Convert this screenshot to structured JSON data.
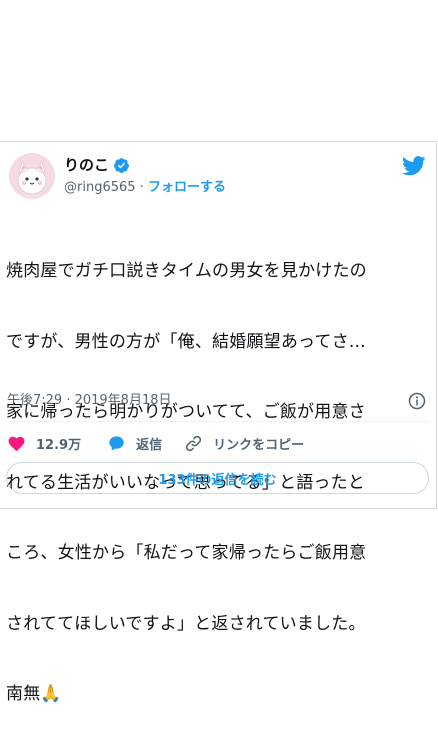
{
  "author": {
    "name": "りのこ",
    "handle": "@ring6565",
    "separator": "·",
    "follow_label": "フォローする"
  },
  "tweet": {
    "lines": [
      "焼肉屋でガチ口説きタイムの男女を見かけたの",
      "ですが、男性の方が「俺、結婚願望あってさ…",
      "家に帰ったら明かりがついてて、ご飯が用意さ",
      "れてる生活がいいなって思ってる」と語ったと",
      "ころ、女性から「私だって家帰ったらご飯用意",
      "されててほしいですよ」と返されていました。",
      "南無🙏"
    ],
    "timestamp": "午後7:29 · 2019年8月18日"
  },
  "actions": {
    "like_count": "12.9万",
    "reply_label": "返信",
    "copy_link_label": "リンクをコピー"
  },
  "replies_button": {
    "label": "133件の返信を読む"
  },
  "icons": {
    "avatar": "cat-avatar-icon",
    "verified": "verified-badge-icon",
    "brand": "twitter-bird-icon",
    "info": "info-icon",
    "like": "heart-icon",
    "reply": "speech-bubble-icon",
    "copy_link": "link-icon"
  },
  "colors": {
    "accent": "#1d9bf0",
    "like": "#f91880",
    "secondary_text": "#536471",
    "border": "#cfd9de"
  }
}
